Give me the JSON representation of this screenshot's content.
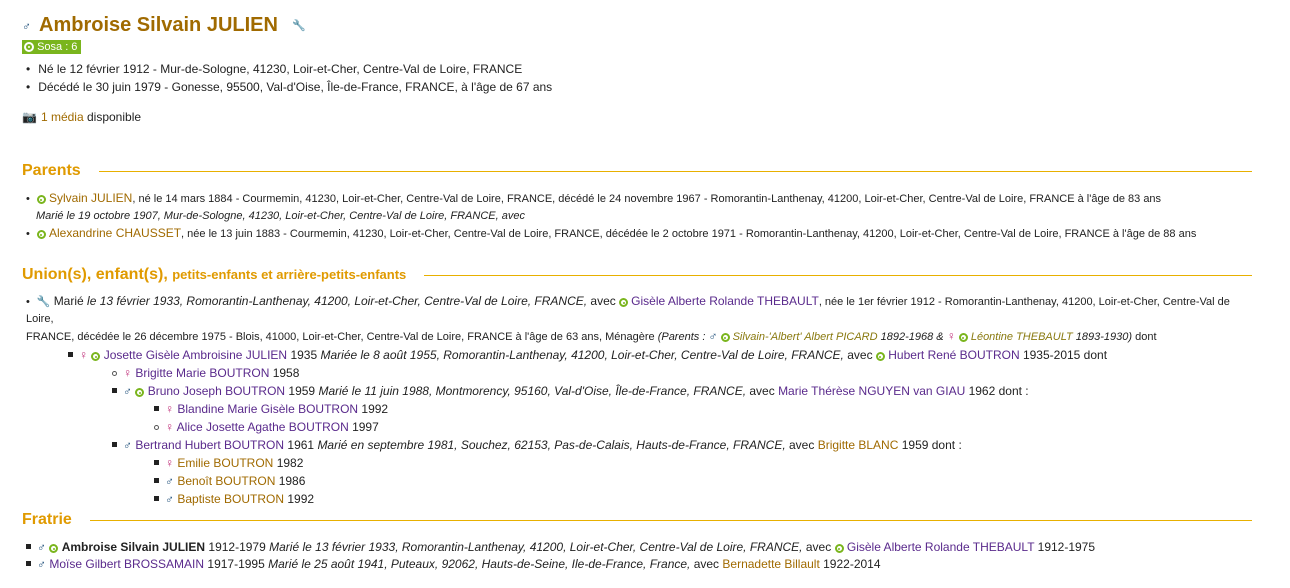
{
  "person": {
    "name": "Ambroise Silvain JULIEN",
    "sosa": "Sosa : 6",
    "birth": "Né le 12 février 1912 - Mur-de-Sologne, 41230, Loir-et-Cher, Centre-Val de Loire, FRANCE",
    "death": "Décédé le 30 juin 1979 - Gonesse, 95500, Val-d'Oise, Île-de-France, FRANCE, à l'âge de 67 ans",
    "media_link": "1 média",
    "media_suffix": " disponible"
  },
  "sections": {
    "parents": "Parents",
    "unions_a": "Union(s), enfant(s), ",
    "unions_b": "petits-enfants",
    "unions_c": " et arrière-petits-enfants",
    "fratrie": "Fratrie"
  },
  "parents": {
    "father_name": "Sylvain JULIEN",
    "father_info": ", né le 14 mars 1884 - Courmemin, 41230, Loir-et-Cher, Centre-Val de Loire, FRANCE, décédé le 24 novembre 1967 - Romorantin-Lanthenay, 41200, Loir-et-Cher, Centre-Val de Loire, FRANCE à l'âge de 83 ans",
    "marriage": "Marié le 19 octobre 1907, Mur-de-Sologne, 41230, Loir-et-Cher, Centre-Val de Loire, FRANCE, avec",
    "mother_name": "Alexandrine CHAUSSET",
    "mother_info": ", née le 13 juin 1883 - Courmemin, 41230, Loir-et-Cher, Centre-Val de Loire, FRANCE, décédée le 2 octobre 1971 - Romorantin-Lanthenay, 41200, Loir-et-Cher, Centre-Val de Loire, FRANCE à l'âge de 88 ans"
  },
  "union": {
    "marie": "Marié",
    "marie_details": " le 13 février 1933, Romorantin-Lanthenay, 41200, Loir-et-Cher, Centre-Val de Loire, FRANCE,",
    "avec": " avec ",
    "spouse": "Gisèle Alberte Rolande THEBAULT",
    "spouse_info_1": ", née le 1er février 1912 - Romorantin-Lanthenay, 41200, Loir-et-Cher, Centre-Val de Loire,",
    "spouse_info_2": "FRANCE, décédée le 26 décembre 1975 - Blois, 41000, Loir-et-Cher, Centre-Val de Loire, FRANCE à l'âge de 63 ans, Ménagère ",
    "parents_label": "(Parents : ",
    "spouse_father": "Silvain-'Albert' Albert PICARD",
    "spouse_father_years": " 1892-1968 & ",
    "spouse_mother": "Léontine THEBAULT",
    "spouse_mother_years": " 1893-1930)",
    "dont": " dont"
  },
  "children": [
    {
      "name": "Josette Gisèle Ambroisine JULIEN",
      "year": " 1935 ",
      "marriage": " Mariée le 8 août 1955, Romorantin-Lanthenay, 41200, Loir-et-Cher, Centre-Val de Loire, FRANCE,",
      "avec": " avec ",
      "spouse": "Hubert René BOUTRON",
      "spouse_years": " 1935-2015 dont"
    }
  ],
  "grandchildren": {
    "g1_name": "Brigitte Marie BOUTRON",
    "g1_year": " 1958",
    "g2_name": "Bruno Joseph BOUTRON",
    "g2_year": " 1959 ",
    "g2_marriage": "Marié le 11 juin 1988, Montmorency, 95160, Val-d'Oise, Île-de-France, FRANCE,",
    "g2_avec": " avec ",
    "g2_spouse": "Marie Thérèse NGUYEN van GIAU",
    "g2_spouse_year": " 1962 dont :",
    "gg1_name": "Blandine Marie Gisèle BOUTRON",
    "gg1_year": " 1992",
    "gg2_name": "Alice Josette Agathe BOUTRON",
    "gg2_year": " 1997",
    "g3_name": "Bertrand Hubert BOUTRON",
    "g3_year": " 1961 ",
    "g3_marriage": "Marié en septembre 1981, Souchez, 62153, Pas-de-Calais, Hauts-de-France, FRANCE,",
    "g3_avec": " avec ",
    "g3_spouse": "Brigitte BLANC",
    "g3_spouse_year": " 1959 dont :",
    "gg3_name": "Emilie BOUTRON",
    "gg3_year": " 1982",
    "gg4_name": "Benoît BOUTRON",
    "gg4_year": " 1986",
    "gg5_name": "Baptiste BOUTRON",
    "gg5_year": " 1992"
  },
  "fratrie": {
    "s1_name": "Ambroise Silvain JULIEN",
    "s1_years": " 1912-1979 ",
    "s1_marriage": "Marié le 13 février 1933, Romorantin-Lanthenay, 41200, Loir-et-Cher, Centre-Val de Loire, FRANCE,",
    "s1_avec": " avec ",
    "s1_spouse": "Gisèle Alberte Rolande THEBAULT",
    "s1_spouse_years": " 1912-1975",
    "s2_name": "Moïse Gilbert BROSSAMAIN",
    "s2_years": " 1917-1995 ",
    "s2_marriage": "Marié le 25 août 1941, Puteaux, 92062, Hauts-de-Seine, Ile-de-France, France,",
    "s2_avec": " avec ",
    "s2_spouse": "Bernadette Billault",
    "s2_spouse_years": " 1922-2014"
  },
  "glyphs": {
    "male": "♂",
    "female": "♀"
  }
}
